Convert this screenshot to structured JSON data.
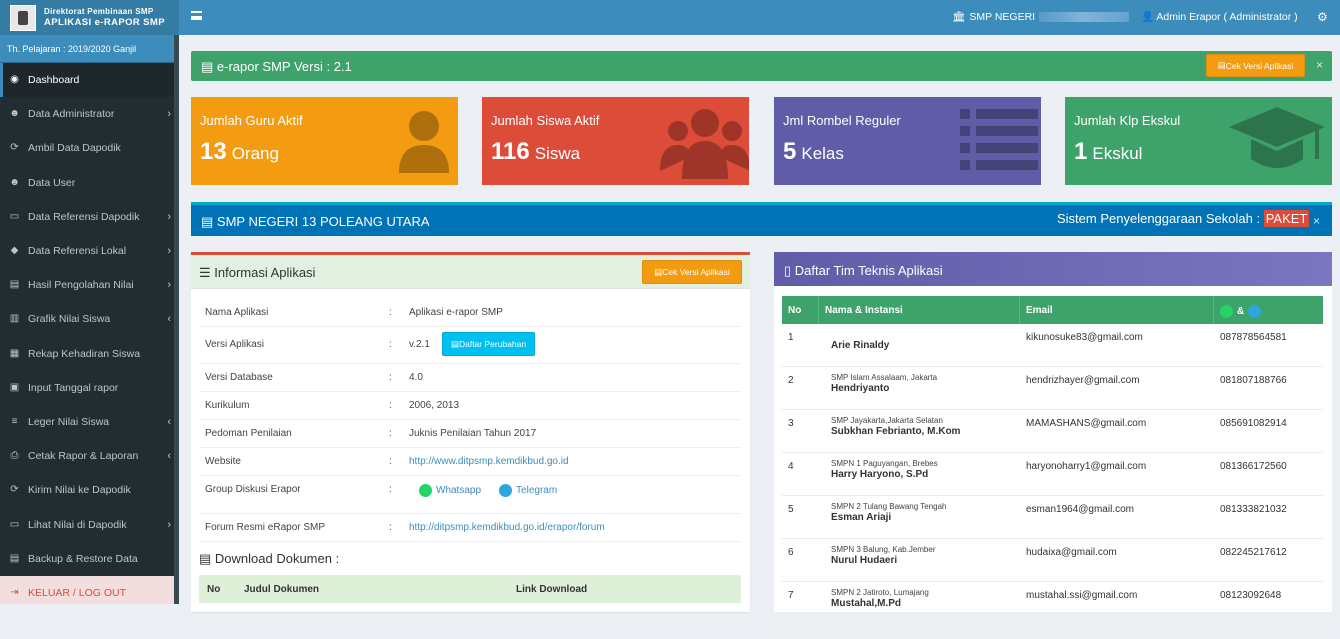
{
  "brand": {
    "line1": "Direktorat Pembinaan SMP",
    "line2": "APLIKASI e-RAPOR SMP"
  },
  "year": "Th. Pelajaran : 2019/2020 Ganjil",
  "topbar": {
    "school": "SMP NEGERI",
    "user": "Admin Erapor ( Administrator )"
  },
  "menu": [
    {
      "label": "Dashboard",
      "icon": "dashboard-icon",
      "glyph": "◉",
      "arrow": ""
    },
    {
      "label": "Data Administrator",
      "icon": "users-icon",
      "glyph": "☻",
      "arrow": "›"
    },
    {
      "label": "Ambil Data Dapodik",
      "icon": "refresh-icon",
      "glyph": "⟳",
      "arrow": ""
    },
    {
      "label": "Data User",
      "icon": "users-icon",
      "glyph": "☻",
      "arrow": ""
    },
    {
      "label": "Data Referensi Dapodik",
      "icon": "desktop-icon",
      "glyph": "▭",
      "arrow": "›"
    },
    {
      "label": "Data Referensi Lokal",
      "icon": "tag-icon",
      "glyph": "◆",
      "arrow": "›"
    },
    {
      "label": "Hasil Pengolahan Nilai",
      "icon": "book-icon",
      "glyph": "▤",
      "arrow": "›"
    },
    {
      "label": "Grafik Nilai Siswa",
      "icon": "chart-icon",
      "glyph": "▥",
      "arrow": "‹"
    },
    {
      "label": "Rekap Kehadiran Siswa",
      "icon": "table-icon",
      "glyph": "▦",
      "arrow": ""
    },
    {
      "label": "Input Tanggal rapor",
      "icon": "calendar-icon",
      "glyph": "▣",
      "arrow": ""
    },
    {
      "label": "Leger Nilai Siswa",
      "icon": "list-icon",
      "glyph": "≡",
      "arrow": "‹"
    },
    {
      "label": "Cetak Rapor & Laporan",
      "icon": "print-icon",
      "glyph": "⎙",
      "arrow": "‹"
    },
    {
      "label": "Kirim Nilai ke Dapodik",
      "icon": "refresh-icon",
      "glyph": "⟳",
      "arrow": ""
    },
    {
      "label": "Lihat Nilai di Dapodik",
      "icon": "window-icon",
      "glyph": "▭",
      "arrow": "›"
    },
    {
      "label": "Backup & Restore Data",
      "icon": "database-icon",
      "glyph": "▤",
      "arrow": ""
    },
    {
      "label": "KELUAR / LOG OUT",
      "icon": "logout-icon",
      "glyph": "⇥",
      "arrow": ""
    }
  ],
  "version_box": {
    "title": "e-rapor SMP Versi : 2.1",
    "button": "Cek Versi Aplikasi",
    "close": "×"
  },
  "stats": [
    {
      "label": "Jumlah Guru Aktif",
      "value": "13",
      "unit": "Orang",
      "color": "#f39c12",
      "icon": "user-icon"
    },
    {
      "label": "Jumlah Siswa Aktif",
      "value": "116",
      "unit": "Siswa",
      "color": "#dd4b39",
      "icon": "group-icon"
    },
    {
      "label": "Jml Rombel Reguler",
      "value": "5",
      "unit": "Kelas",
      "color": "#605ca8",
      "icon": "list-icon"
    },
    {
      "label": "Jumlah Klp Ekskul",
      "value": "1",
      "unit": "Ekskul",
      "color": "#3ea36a",
      "icon": "graduation-cap-icon"
    }
  ],
  "school_bar": {
    "name": "SMP NEGERI 13 POLEANG UTARA",
    "sys_label": "Sistem Penyelenggaraan Sekolah :",
    "sys_value": "PAKET",
    "close": "×"
  },
  "info": {
    "title": "Informasi Aplikasi",
    "button": "Cek Versi Aplikasi",
    "rows": [
      {
        "k": "Nama Aplikasi",
        "v": "Aplikasi e-rapor SMP"
      },
      {
        "k": "Versi Aplikasi",
        "v": "v.2.1",
        "btn": "Daftar Perubahan"
      },
      {
        "k": "Versi Database",
        "v": "4.0"
      },
      {
        "k": "Kurikulum",
        "v": "2006, 2013"
      },
      {
        "k": "Pedoman Penilaian",
        "v": "Juknis Penilaian Tahun 2017"
      },
      {
        "k": "Website",
        "v": "http://www.ditpsmp.kemdikbud.go.id",
        "link": true
      },
      {
        "k": "Group Diskusi Erapor",
        "wa": "Whatsapp",
        "tg": "Telegram"
      },
      {
        "k": "Forum Resmi eRapor SMP",
        "v": "http://ditpsmp.kemdikbud.go.id/erapor/forum",
        "link": true
      }
    ],
    "colon": ":"
  },
  "download": {
    "title": "Download Dokumen :",
    "cols": [
      "No",
      "Judul Dokumen",
      "Link Download"
    ]
  },
  "team": {
    "title": "Daftar Tim Teknis Aplikasi",
    "cols": [
      "No",
      "Nama & Instansi",
      "Email",
      "&"
    ],
    "rows": [
      {
        "no": "1",
        "name": "Arie Rinaldy",
        "inst": "SMP Islam Assalaam, Jakarta",
        "email": "kikunosuke83@gmail.com",
        "phone": "087878564581"
      },
      {
        "no": "2",
        "name": "Hendriyanto",
        "inst": "SMP Jayakarta,Jakarta Selatan",
        "email": "hendrizhayer@gmail.com",
        "phone": "081807188766"
      },
      {
        "no": "3",
        "name": "Subkhan Febrianto, M.Kom",
        "inst": "SMPN 1 Paguyangan, Brebes",
        "email": "MAMASHANS@gmail.com",
        "phone": "085691082914"
      },
      {
        "no": "4",
        "name": "Harry Haryono, S.Pd",
        "inst": "SMPN 2 Tulang Bawang Tengah",
        "email": "haryonoharry1@gmail.com",
        "phone": "081366172560"
      },
      {
        "no": "5",
        "name": "Esman Ariaji",
        "inst": "SMPN 3 Balung, Kab.Jember",
        "email": "esman1964@gmail.com",
        "phone": "081333821032"
      },
      {
        "no": "6",
        "name": "Nurul Hudaeri",
        "inst": "SMPN 2 Jatiroto, Lumajang",
        "email": "hudaixa@gmail.com",
        "phone": "082245217612"
      },
      {
        "no": "7",
        "name": "Mustahal,M.Pd",
        "inst": "",
        "email": "mustahal.ssi@gmail.com",
        "phone": "08123092648"
      }
    ]
  }
}
